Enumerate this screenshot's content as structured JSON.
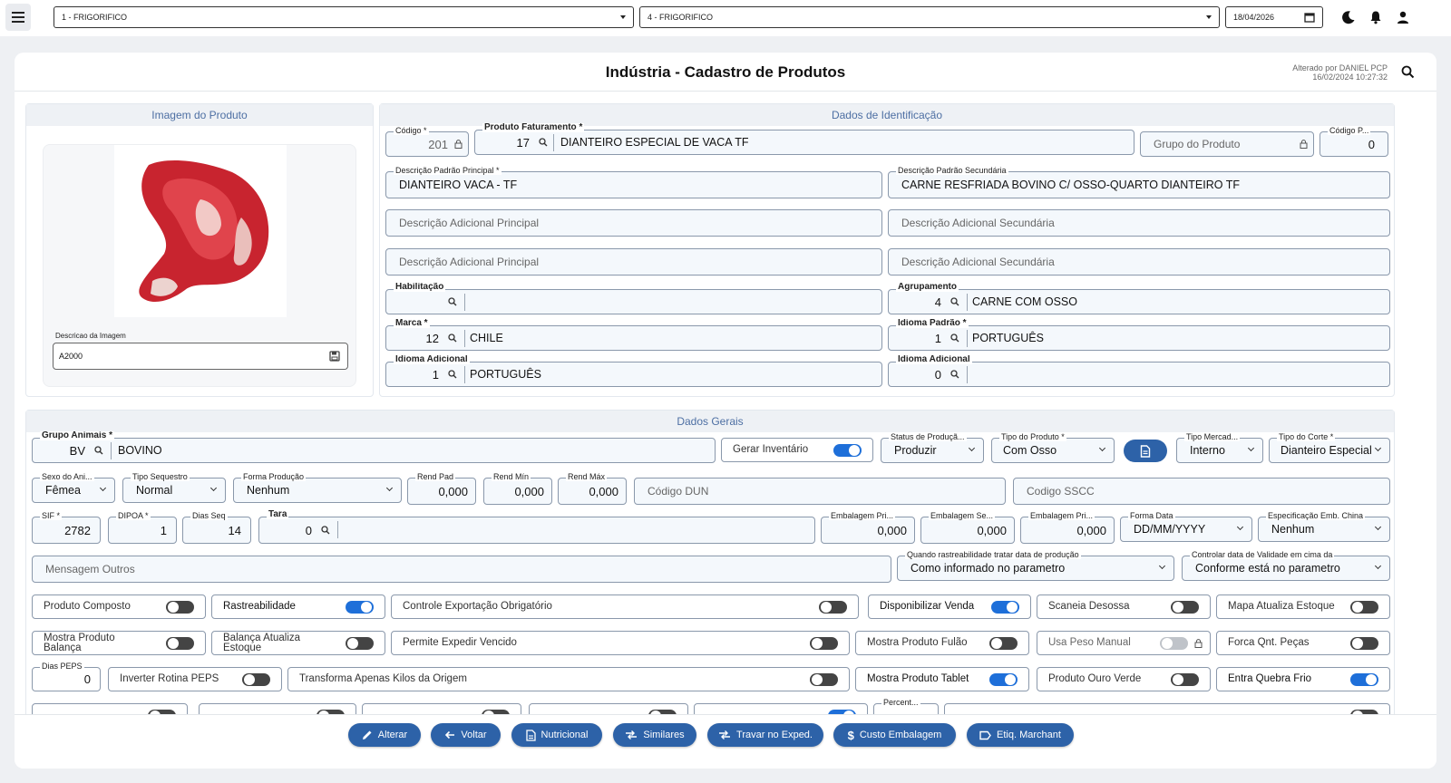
{
  "topbar": {
    "company": "1 - FRIGORIFICO",
    "branch": "4 - FRIGORIFICO",
    "date": "18/04/2026",
    "icons": [
      "menu-icon",
      "calendar-icon",
      "moon-icon",
      "bell-icon",
      "user-icon"
    ]
  },
  "page": {
    "title": "Indústria - Cadastro de Produtos",
    "altered_by": "Alterado por DANIEL PCP",
    "altered_at": "16/02/2024 10:27:32"
  },
  "image_section": {
    "title": "Imagem do Produto",
    "desc_label": "Descricao da Imagem",
    "desc_value": "A2000"
  },
  "ident": {
    "title": "Dados de Identificação",
    "codigo": {
      "label": "Código *",
      "value": "201"
    },
    "produto_fat": {
      "label": "Produto Faturamento *",
      "code": "17",
      "desc": "DIANTEIRO ESPECIAL DE VACA TF"
    },
    "grupo_produto": {
      "placeholder": "Grupo do Produto"
    },
    "codigo_p": {
      "label": "Código P...",
      "value": "0"
    },
    "desc_principal": {
      "label": "Descrição Padrão Principal *",
      "value": "DIANTEIRO VACA - TF"
    },
    "desc_secundaria": {
      "label": "Descrição Padrão Secundária",
      "value": "CARNE RESFRIADA BOVINO C/ OSSO-QUARTO DIANTEIRO TF"
    },
    "adic_principal_1": "Descrição Adicional Principal",
    "adic_secundaria_1": "Descrição Adicional Secundária",
    "adic_principal_2": "Descrição Adicional Principal",
    "adic_secundaria_2": "Descrição Adicional Secundária",
    "habilitacao": {
      "label": "Habilitação"
    },
    "agrupamento": {
      "label": "Agrupamento",
      "code": "4",
      "desc": "CARNE COM OSSO"
    },
    "marca": {
      "label": "Marca *",
      "code": "12",
      "desc": "CHILE"
    },
    "idioma_padrao": {
      "label": "Idioma Padrão *",
      "code": "1",
      "desc": "PORTUGUÊS"
    },
    "idioma_adicional_1": {
      "label": "Idioma Adicional",
      "code": "1",
      "desc": "PORTUGUÊS"
    },
    "idioma_adicional_2": {
      "label": "Idioma Adicional",
      "code": "0"
    }
  },
  "gerais": {
    "title": "Dados Gerais",
    "grupo_animais": {
      "label": "Grupo Animais *",
      "code": "BV",
      "desc": "BOVINO"
    },
    "gerar_inventario": {
      "label": "Gerar Inventário",
      "on": true
    },
    "status_producao": {
      "label": "Status de Produçã...",
      "value": "Produzir"
    },
    "tipo_produto": {
      "label": "Tipo do Produto *",
      "value": "Com Osso"
    },
    "tipo_mercado": {
      "label": "Tipo Mercad...",
      "value": "Interno"
    },
    "tipo_corte": {
      "label": "Tipo do Corte *",
      "value": "Dianteiro Especial"
    },
    "sexo_animal": {
      "label": "Sexo do Ani...",
      "value": "Fêmea"
    },
    "tipo_sequestro": {
      "label": "Tipo Sequestro",
      "value": "Normal"
    },
    "forma_producao": {
      "label": "Forma Produção",
      "value": "Nenhum"
    },
    "rend_pad": {
      "label": "Rend Pad",
      "value": "0,000"
    },
    "rend_min": {
      "label": "Rend Mín",
      "value": "0,000"
    },
    "rend_max": {
      "label": "Rend Máx",
      "value": "0,000"
    },
    "codigo_dun": "Código DUN",
    "codigo_sscc": "Codigo SSCC",
    "sif": {
      "label": "SIF *",
      "value": "2782"
    },
    "dipoa": {
      "label": "DIPOA *",
      "value": "1"
    },
    "dias_seq": {
      "label": "Dias Seq",
      "value": "14"
    },
    "tara": {
      "label": "Tara",
      "value": "0"
    },
    "emb_pri_1": {
      "label": "Embalagem Pri...",
      "value": "0,000"
    },
    "emb_se": {
      "label": "Embalagem Se...",
      "value": "0,000"
    },
    "emb_pri_2": {
      "label": "Embalagem Pri...",
      "value": "0,000"
    },
    "forma_data": {
      "label": "Forma Data",
      "value": "DD/MM/YYYY"
    },
    "espec_china": {
      "label": "Especificação Emb. China",
      "value": "Nenhum"
    },
    "mensagem_outros": "Mensagem Outros",
    "rastreab_data": {
      "label": "Quando rastreabilidade tratar data de produção",
      "value": "Como informado no parametro"
    },
    "controle_validade": {
      "label": "Controlar data de Validade em cima da",
      "value": "Conforme está no parametro"
    },
    "dias_peps": {
      "label": "Dias PEPS",
      "value": "0"
    },
    "percent_label": "Percent..."
  },
  "toggles": {
    "produto_composto": {
      "label": "Produto Composto",
      "on": false
    },
    "rastreabilidade": {
      "label": "Rastreabilidade",
      "on": true
    },
    "controle_exportacao": {
      "label": "Controle Exportação Obrigatório",
      "on": false
    },
    "disponibilizar_venda": {
      "label": "Disponibilizar Venda",
      "on": true
    },
    "scaneia_desossa": {
      "label": "Scaneia Desossa",
      "on": false
    },
    "mapa_atualiza": {
      "label": "Mapa Atualiza  Estoque",
      "on": false
    },
    "mostra_balanca_1": "Mostra Produto",
    "mostra_balanca_2": "Balança",
    "balanca_estoque_1": "Balança Atualiza",
    "balanca_estoque_2": "Estoque",
    "permite_expedir": {
      "label": "Permite Expedir  Vencido",
      "on": false
    },
    "mostra_fulao": {
      "label": "Mostra Produto Fulão",
      "on": false
    },
    "usa_peso_manual": {
      "label": "Usa Peso Manual",
      "on": false
    },
    "forca_qnt": {
      "label": "Forca Qnt.  Peças",
      "on": false
    },
    "inverter_rotina": {
      "label": "Inverter Rotina  PEPS",
      "on": false
    },
    "transforma_kilos": {
      "label": "Transforma Apenas Kilos da Origem",
      "on": false
    },
    "mostra_tablet": {
      "label": "Mostra Produto Tablet",
      "on": true
    },
    "produto_ouro_verde": {
      "label": "Produto Ouro Verde",
      "on": false
    },
    "entra_quebra_frio": {
      "label": "Entra Quebra Frio",
      "on": true
    }
  },
  "buttons": {
    "alterar": "Alterar",
    "voltar": "Voltar",
    "nutricional": "Nutricional",
    "similares": "Similares",
    "travar": "Travar no Exped.",
    "custo": "Custo Embalagem",
    "etiq": "Etiq. Marchant"
  },
  "colors": {
    "accent": "#1e6fd9",
    "button": "#2d62a8",
    "section_title": "#4d6fa3"
  }
}
